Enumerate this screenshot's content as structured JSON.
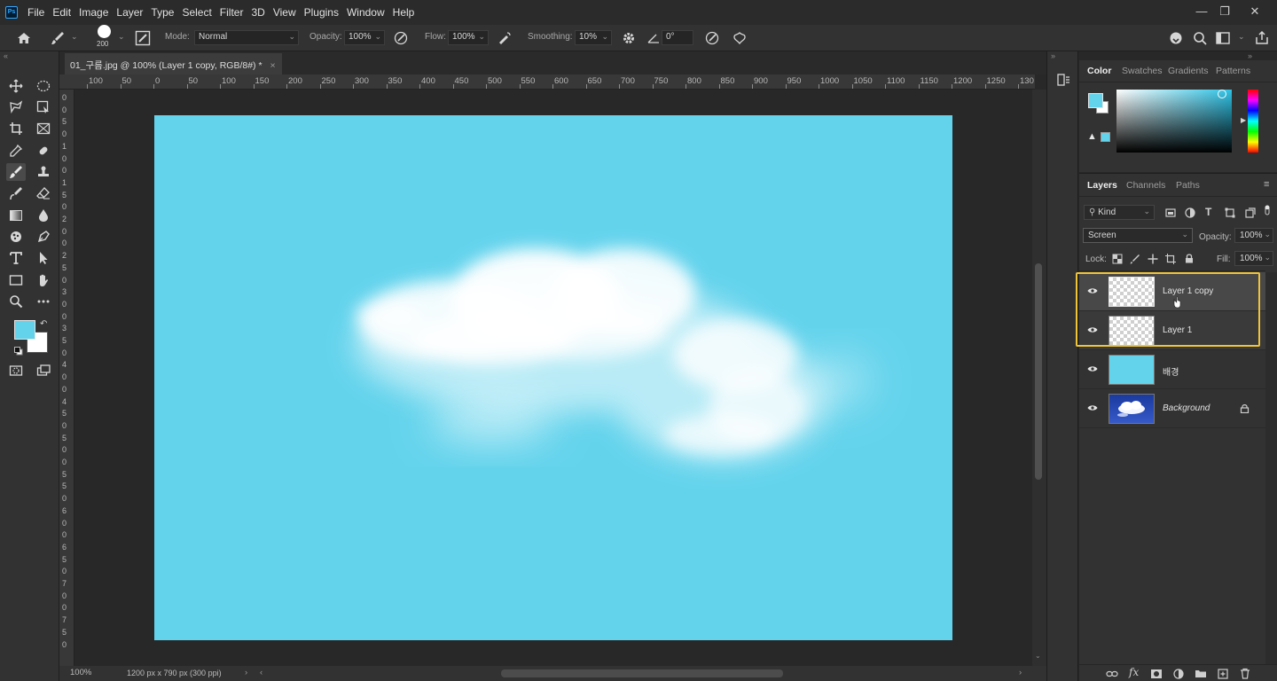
{
  "app": {
    "logo_text": "Ps"
  },
  "menu": [
    "File",
    "Edit",
    "Image",
    "Layer",
    "Type",
    "Select",
    "Filter",
    "3D",
    "View",
    "Plugins",
    "Window",
    "Help"
  ],
  "options": {
    "brush_size": "200",
    "mode_label": "Mode:",
    "mode_value": "Normal",
    "opacity_label": "Opacity:",
    "opacity_value": "100%",
    "flow_label": "Flow:",
    "flow_value": "100%",
    "smoothing_label": "Smoothing:",
    "smoothing_value": "10%",
    "angle_value": "0°"
  },
  "document": {
    "tab_title": "01_구름.jpg @ 100% (Layer 1 copy, RGB/8#) *",
    "zoom": "100%",
    "doc_info": "1200 px x 790 px (300 ppi)",
    "canvas_color": "#63d3ec"
  },
  "ruler_h": [
    "100",
    "50",
    "0",
    "50",
    "100",
    "150",
    "200",
    "250",
    "300",
    "350",
    "400",
    "450",
    "500",
    "550",
    "600",
    "650",
    "700",
    "750",
    "800",
    "850",
    "900",
    "950",
    "1000",
    "1050",
    "1100",
    "1150",
    "1200",
    "1250",
    "130"
  ],
  "ruler_v": [
    "0",
    "0",
    "5",
    "0",
    "1",
    "0",
    "0",
    "1",
    "5",
    "0",
    "2",
    "0",
    "0",
    "2",
    "5",
    "0",
    "3",
    "0",
    "0",
    "3",
    "5",
    "0",
    "4",
    "0",
    "0",
    "4",
    "5",
    "0",
    "5",
    "0",
    "0",
    "5",
    "5",
    "0",
    "6",
    "0",
    "0",
    "6",
    "5",
    "0",
    "7",
    "0",
    "0",
    "7",
    "5",
    "0"
  ],
  "color_panel": {
    "tabs": [
      "Color",
      "Swatches",
      "Gradients",
      "Patterns"
    ],
    "foreground": "#63d3ec",
    "background": "#ffffff"
  },
  "layers_panel": {
    "tabs": [
      "Layers",
      "Channels",
      "Paths"
    ],
    "filter_kind": "Kind",
    "blend_mode": "Screen",
    "opacity_label": "Opacity:",
    "opacity_value": "100%",
    "lock_label": "Lock:",
    "fill_label": "Fill:",
    "fill_value": "100%",
    "layers": [
      {
        "name": "Layer 1 copy",
        "visible": true,
        "selected": true
      },
      {
        "name": "Layer 1",
        "visible": true,
        "selected": false
      },
      {
        "name": "배경",
        "visible": true,
        "selected": false
      },
      {
        "name": "Background",
        "visible": true,
        "selected": false,
        "locked": true
      }
    ]
  },
  "highlight_color": "#f0c43a"
}
